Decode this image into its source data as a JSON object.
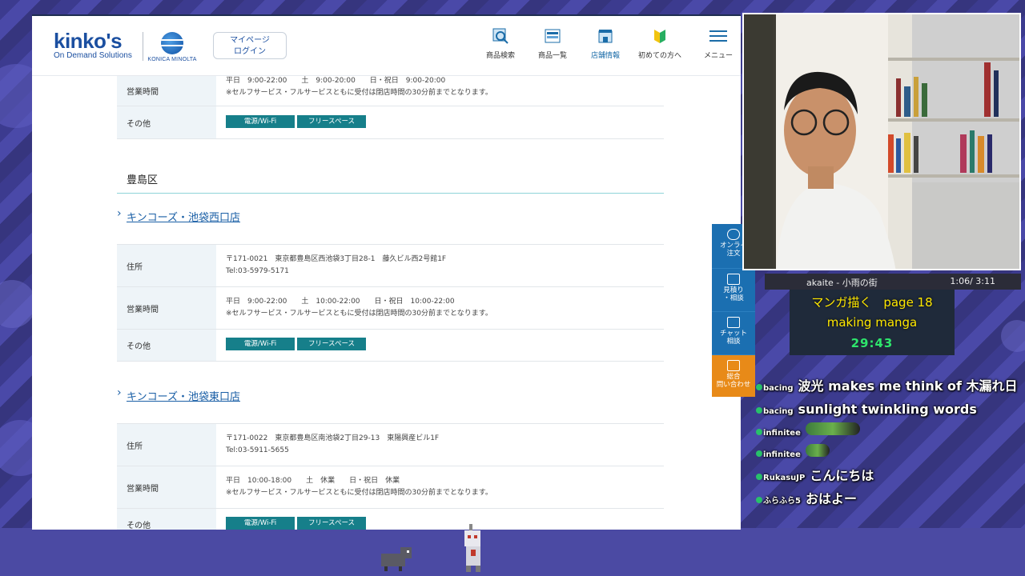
{
  "header": {
    "logo_main": "kinko's",
    "logo_sub": "On Demand Solutions",
    "partner": "KONICA MINOLTA",
    "mypage_label_1": "マイページ",
    "mypage_label_2": "ログイン",
    "nav": [
      {
        "label": "商品検索",
        "icon": "search-product-icon"
      },
      {
        "label": "商品一覧",
        "icon": "product-list-icon"
      },
      {
        "label": "店舗情報",
        "icon": "store-info-icon"
      },
      {
        "label": "初めての方へ",
        "icon": "beginner-mark-icon"
      },
      {
        "label": "メニュー",
        "icon": "hamburger-menu-icon"
      }
    ]
  },
  "top_block": {
    "hours_label": "営業時間",
    "hours_line1": "平日　9:00-22:00　　土　9:00-20:00　　日・祝日　9:00-20:00",
    "hours_note": "※セルフサービス・フルサービスともに受付は閉店時間の30分前までとなります。",
    "other_label": "その他",
    "tags": [
      "電源/Wi-Fi",
      "フリースペース"
    ]
  },
  "ward": "豊島区",
  "stores": [
    {
      "name": "キンコーズ・池袋西口店",
      "address_label": "住所",
      "address": "〒171-0021　東京都豊島区西池袋3丁目28-1　藤久ビル西2号館1F",
      "tel": "Tel:03-5979-5171",
      "hours_label": "営業時間",
      "hours": "平日　9:00-22:00　　土　10:00-22:00　　日・祝日　10:00-22:00",
      "note": "※セルフサービス・フルサービスともに受付は閉店時間の30分前までとなります。",
      "other_label": "その他",
      "tags": [
        "電源/Wi-Fi",
        "フリースペース"
      ]
    },
    {
      "name": "キンコーズ・池袋東口店",
      "address_label": "住所",
      "address": "〒171-0022　東京都豊島区南池袋2丁目29-13　東陽興産ビル1F",
      "tel": "Tel:03-5911-5655",
      "hours_label": "営業時間",
      "hours": "平日　10:00-18:00　　土　休業　　日・祝日　休業",
      "note": "※セルフサービス・フルサービスともに受付は閉店時間の30分前までとなります。",
      "other_label": "その他",
      "tags": [
        "電源/Wi-Fi",
        "フリースペース"
      ]
    }
  ],
  "side_tabs": [
    {
      "label_1": "オンライ",
      "label_2": "注文"
    },
    {
      "label_1": "見積り",
      "label_2": "・相談"
    },
    {
      "label_1": "チャット",
      "label_2": "相談"
    },
    {
      "label_1": "総合",
      "label_2": "問い合わせ"
    }
  ],
  "music": {
    "title": "akaite - 小雨の街",
    "time": "1:06/ 3:11"
  },
  "task": {
    "line1": "マンガ描く　page 18",
    "line2": "making manga",
    "timer": "29:43"
  },
  "chat": [
    {
      "user": "bacing",
      "msg": "波光 makes me think of 木漏れ日"
    },
    {
      "user": "bacing",
      "msg": "sunlight twinkling words"
    },
    {
      "user": "infinitee",
      "msg": ""
    },
    {
      "user": "infinitee",
      "msg": ""
    },
    {
      "user": "RukasuJP",
      "msg": "こんにちは"
    },
    {
      "user": "ふらふら5",
      "msg": "おはよー"
    }
  ],
  "colors": {
    "brand": "#1b4fa0",
    "tag": "#167f8a",
    "tab_blue": "#1b6fb1",
    "tab_orange": "#e88a18",
    "overlay": "#4a49a8"
  }
}
